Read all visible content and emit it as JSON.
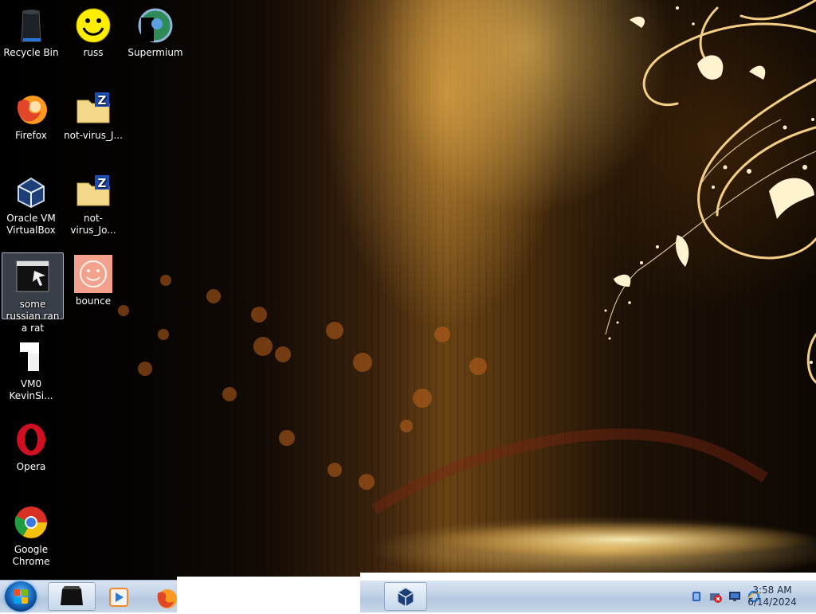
{
  "desktop": {
    "icons": [
      {
        "name": "recycle-bin",
        "label": "Recycle Bin"
      },
      {
        "name": "russ",
        "label": "russ"
      },
      {
        "name": "supermium",
        "label": "Supermium"
      },
      {
        "name": "firefox",
        "label": "Firefox"
      },
      {
        "name": "not-virus-1",
        "label": "not-virus_J..."
      },
      {
        "name": "oracle-vm-virtualbox",
        "label": "Oracle VM VirtualBox"
      },
      {
        "name": "not-virus-2",
        "label": "not-virus_Jo..."
      },
      {
        "name": "some-russian-ran-a-rat",
        "label": "some russian ran a rat",
        "selected": true
      },
      {
        "name": "bounce",
        "label": "bounce"
      },
      {
        "name": "vm0-kevinsi",
        "label": "VM0 KevinSi..."
      },
      {
        "name": "opera",
        "label": "Opera"
      },
      {
        "name": "google-chrome",
        "label": "Google Chrome"
      }
    ]
  },
  "taskbar": {
    "pinned": [
      "cmd-window-icon",
      "media-player-icon",
      "firefox-icon",
      "virtualbox-icon"
    ],
    "tray_icons": [
      "shield-icon",
      "network-error-icon",
      "monitor-icon",
      "ie-icon"
    ],
    "clock": {
      "time": "3:58 AM",
      "date": "6/14/2024"
    }
  },
  "colors": {
    "accent": "#1b6fc7",
    "taskbar": "#c4d4e8"
  }
}
